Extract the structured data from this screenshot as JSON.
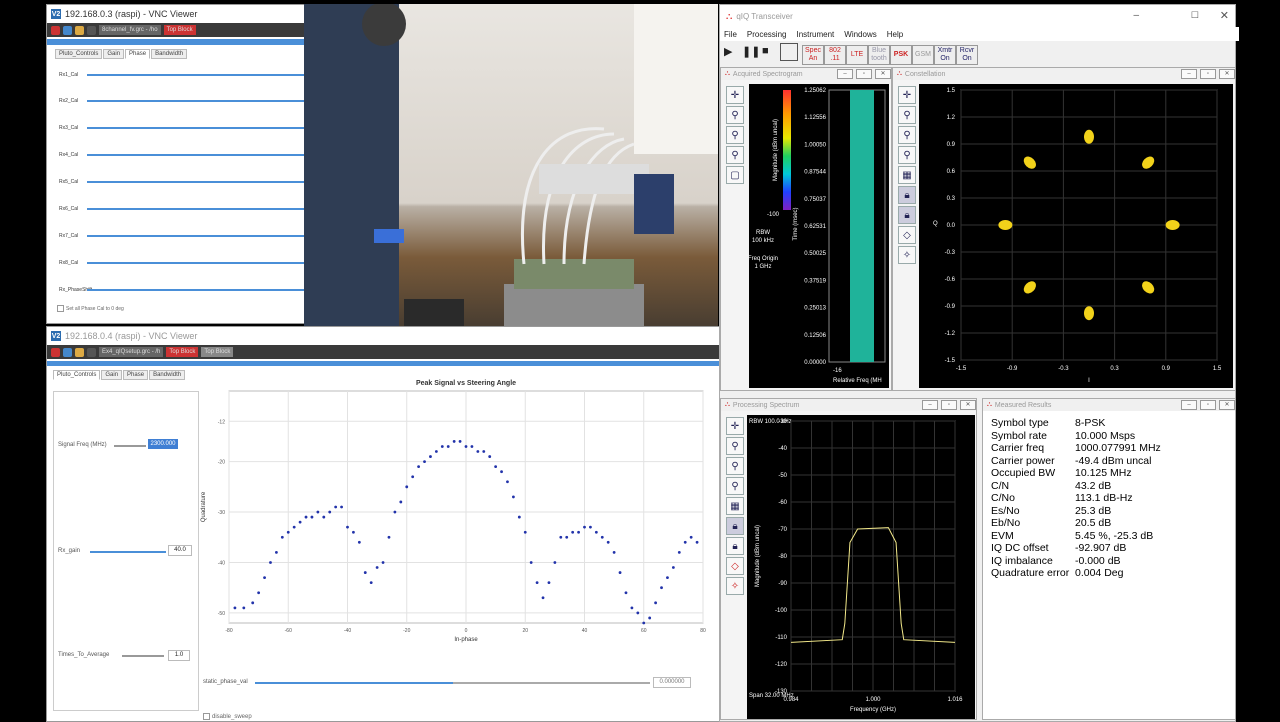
{
  "vnc1": {
    "title": "192.168.0.3 (raspi) - VNC Viewer",
    "tasks": [
      "8channel_fv.grc - /ho",
      "Top Block"
    ],
    "tabs": [
      "Pluto_Controls",
      "Gain",
      "Phase",
      "Bandwidth"
    ],
    "rows": [
      "Rx1_Cal",
      "Rx2_Cal",
      "Rx3_Cal",
      "Rx4_Cal",
      "Rx5_Cal",
      "Rx6_Cal",
      "Rx7_Cal",
      "Rx8_Cal",
      "Rx_PhaseShift"
    ],
    "checkbox": "Set all Phase Cal to 0 deg"
  },
  "vnc2": {
    "title": "192.168.0.4 (raspi) - VNC Viewer",
    "tasks": [
      "Ex4_qIQsetup.grc - /h",
      "Top Block",
      "Top Block"
    ],
    "tabs": [
      "Pluto_Controls",
      "Gain",
      "Phase",
      "Bandwidth"
    ],
    "signal_freq_label": "Signal Freq (MHz)",
    "signal_freq_value": "2300.000",
    "rx_gain_label": "Rx_gain",
    "rx_gain_value": "40.0",
    "times_label": "Times_To_Average",
    "times_value": "1.0",
    "static_phase_label": "static_phase_val",
    "static_phase_value": "0.000000",
    "disable_sweep": "disable_sweep"
  },
  "steer_chart": {
    "title": "Peak Signal vs Steering Angle",
    "xlabel": "In-phase",
    "ylabel": "Quadrature",
    "xticks": [
      "-80",
      "-60",
      "-40",
      "-20",
      "0",
      "20",
      "40",
      "60",
      "80"
    ],
    "yticks": [
      "-12",
      "-20",
      "-30",
      "-40",
      "-50"
    ]
  },
  "chart_data": {
    "type": "scatter",
    "title": "Peak Signal vs Steering Angle",
    "xlabel": "In-phase",
    "ylabel": "Quadrature",
    "xlim": [
      -80,
      80
    ],
    "ylim": [
      -52,
      -6
    ],
    "x": [
      -78,
      -75,
      -72,
      -70,
      -68,
      -66,
      -64,
      -62,
      -60,
      -58,
      -56,
      -54,
      -52,
      -50,
      -48,
      -46,
      -44,
      -42,
      -40,
      -38,
      -36,
      -34,
      -32,
      -30,
      -28,
      -26,
      -24,
      -22,
      -20,
      -18,
      -16,
      -14,
      -12,
      -10,
      -8,
      -6,
      -4,
      -2,
      0,
      2,
      4,
      6,
      8,
      10,
      12,
      14,
      16,
      18,
      20,
      22,
      24,
      26,
      28,
      30,
      32,
      34,
      36,
      38,
      40,
      42,
      44,
      46,
      48,
      50,
      52,
      54,
      56,
      58,
      60,
      62,
      64,
      66,
      68,
      70,
      72,
      74,
      76,
      78
    ],
    "y": [
      -49,
      -49,
      -48,
      -46,
      -43,
      -40,
      -38,
      -35,
      -34,
      -33,
      -32,
      -31,
      -31,
      -30,
      -31,
      -30,
      -29,
      -29,
      -33,
      -34,
      -36,
      -42,
      -44,
      -41,
      -40,
      -35,
      -30,
      -28,
      -25,
      -23,
      -21,
      -20,
      -19,
      -18,
      -17,
      -17,
      -16,
      -16,
      -17,
      -17,
      -18,
      -18,
      -19,
      -21,
      -22,
      -24,
      -27,
      -31,
      -34,
      -40,
      -44,
      -47,
      -44,
      -40,
      -35,
      -35,
      -34,
      -34,
      -33,
      -33,
      -34,
      -35,
      -36,
      -38,
      -42,
      -46,
      -49,
      -50,
      -52,
      -51,
      -48,
      -45,
      -43,
      -41,
      -38,
      -36,
      -35,
      -36
    ]
  },
  "qiq": {
    "title": "qIQ Transceiver",
    "menu": [
      "File",
      "Processing",
      "Instrument",
      "Windows",
      "Help"
    ],
    "toolbar": [
      "Spec An",
      "802 .11",
      "LTE",
      "Blue tooth",
      "PSK",
      "GSM",
      "Xmtr On",
      "Rcvr On"
    ],
    "spectrogram": {
      "title": "Acquired Spectrogram",
      "cbar_label": "Magnitude (dBm uncal)",
      "cbar_min": "-100",
      "rbw_label": "RBW",
      "rbw_value": "100 kHz",
      "freq_origin_label": "Freq Origin",
      "freq_origin_value": "1 GHz",
      "time_label": "Time (msec)",
      "time_ticks": [
        "1.25062",
        "1.12556",
        "1.00050",
        "0.87544",
        "0.75037",
        "0.62531",
        "0.50025",
        "0.37519",
        "0.25013",
        "0.12506",
        "0.00000"
      ],
      "x_min": "-16",
      "x_label": "Relative Freq (MH"
    },
    "constellation": {
      "title": "Constellation",
      "ylabel": "Q",
      "xlabel": "I",
      "ticks": [
        "1.5",
        "1.2",
        "0.9",
        "0.6",
        "0.3",
        "0.0",
        "-0.3",
        "-0.6",
        "-0.9",
        "-1.2",
        "-1.5"
      ],
      "xticks": [
        "-1.5",
        "-0.9",
        "-0.3",
        "0.3",
        "0.9",
        "1.5"
      ]
    },
    "spectrum": {
      "title": "Processing Spectrum",
      "rbw": "RBW 100.0 kHz",
      "ylabel": "Magnitude (dBm uncal)",
      "yticks": [
        "-30",
        "-40",
        "-50",
        "-60",
        "-70",
        "-80",
        "-90",
        "-100",
        "-110",
        "-120",
        "-130"
      ],
      "xticks": [
        "0.984",
        "1.000",
        "1.016"
      ],
      "xlabel": "Frequency (GHz)",
      "span": "Span 32.00 MHz"
    },
    "measured": {
      "title": "Measured Results",
      "rows": [
        {
          "k": "Symbol type",
          "v": "8-PSK"
        },
        {
          "k": "Symbol rate",
          "v": "10.000 Msps"
        },
        {
          "k": "Carrier freq",
          "v": "1000.077991 MHz"
        },
        {
          "k": "Carrier power",
          "v": "-49.4 dBm uncal"
        },
        {
          "k": "Occupied BW",
          "v": "10.125 MHz"
        },
        {
          "k": "C/N",
          "v": "43.2 dB"
        },
        {
          "k": "C/No",
          "v": "113.1 dB-Hz"
        },
        {
          "k": "Es/No",
          "v": "25.3 dB"
        },
        {
          "k": "Eb/No",
          "v": "20.5 dB"
        },
        {
          "k": "EVM",
          "v": "5.45 %, -25.3 dB"
        },
        {
          "k": "IQ DC offset",
          "v": "-92.907 dB"
        },
        {
          "k": "IQ imbalance",
          "v": "-0.000 dB"
        },
        {
          "k": "Quadrature error",
          "v": "0.004 Deg"
        }
      ]
    }
  }
}
